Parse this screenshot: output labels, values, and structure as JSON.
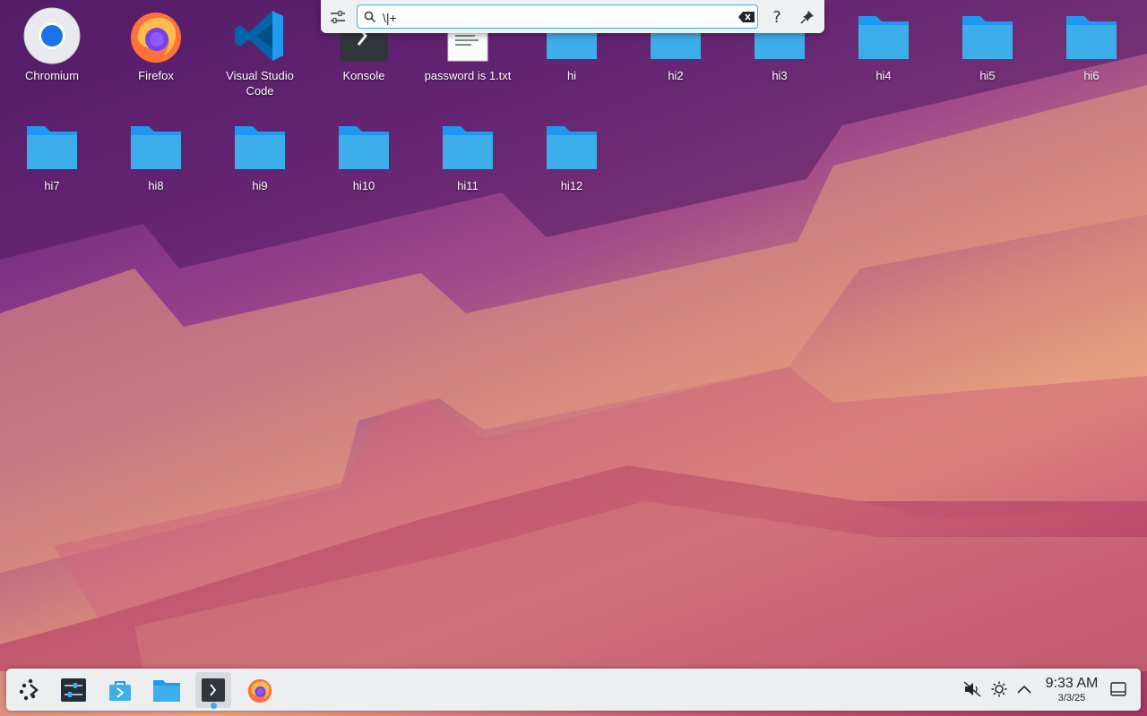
{
  "desktop": {
    "icons": [
      {
        "label": "Chromium",
        "kind": "chromium-icon"
      },
      {
        "label": "Firefox",
        "kind": "firefox-icon"
      },
      {
        "label": "Visual Studio Code",
        "kind": "vscode-icon"
      },
      {
        "label": "Konsole",
        "kind": "konsole-icon"
      },
      {
        "label": "password is 1.txt",
        "kind": "text-file-icon"
      },
      {
        "label": "hi",
        "kind": "folder-icon"
      },
      {
        "label": "hi2",
        "kind": "folder-icon"
      },
      {
        "label": "hi3",
        "kind": "folder-icon"
      },
      {
        "label": "hi4",
        "kind": "folder-icon"
      },
      {
        "label": "hi5",
        "kind": "folder-icon"
      },
      {
        "label": "hi6",
        "kind": "folder-icon"
      },
      {
        "label": "hi7",
        "kind": "folder-icon"
      },
      {
        "label": "hi8",
        "kind": "folder-icon"
      },
      {
        "label": "hi9",
        "kind": "folder-icon"
      },
      {
        "label": "hi10",
        "kind": "folder-icon"
      },
      {
        "label": "hi11",
        "kind": "folder-icon"
      },
      {
        "label": "hi12",
        "kind": "folder-icon"
      }
    ]
  },
  "krunner": {
    "query": "\\|+",
    "buttons": [
      "configure-icon",
      "clear-icon",
      "help-icon",
      "pin-icon"
    ]
  },
  "taskbar": {
    "launchers": [
      "app-launcher-icon",
      "system-settings-icon",
      "discover-icon",
      "dolphin-icon",
      "konsole-icon",
      "firefox-icon"
    ],
    "tray": [
      "volume-muted-icon",
      "brightness-icon",
      "expand-tray-icon",
      "show-desktop-icon"
    ],
    "clock": {
      "time": "9:33 AM",
      "date": "3/3/25"
    }
  },
  "colors": {
    "folder": "#3daee9",
    "accent": "#3daee9",
    "panel": "#eceeef"
  }
}
